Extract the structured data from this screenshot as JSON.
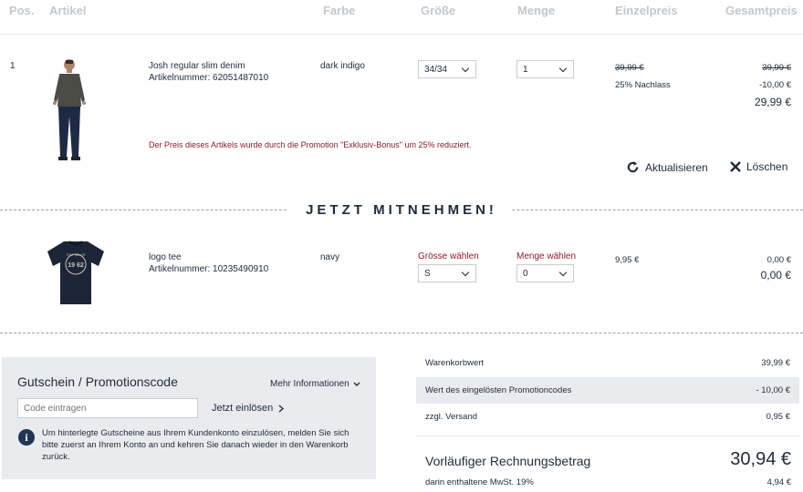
{
  "header": {
    "pos": "Pos.",
    "artikel": "Artikel",
    "farbe": "Farbe",
    "groesse": "Größe",
    "menge": "Menge",
    "einzelpreis": "Einzelpreis",
    "gesamtpreis": "Gesamtpreis"
  },
  "item1": {
    "pos": "1",
    "name": "Josh regular slim denim",
    "article_no": "Artikelnummer: 62051487010",
    "color": "dark indigo",
    "size": "34/34",
    "qty": "1",
    "unit_price_old": "39,99 €",
    "discount_label": "25% Nachlass",
    "total_old": "39,99 €",
    "total_discount": "-10,00 €",
    "total_new": "29,99 €",
    "promo_note": "Der Preis dieses Artikels wurde durch die Promotion \"Exklusiv-Bonus\" um 25% reduziert.",
    "update_label": "Aktualisieren",
    "delete_label": "Löschen"
  },
  "banner": "JETZT MITNEHMEN!",
  "item2": {
    "name": "logo tee",
    "article_no": "Artikelnummer: 10235490910",
    "color": "navy",
    "size_label": "Grösse wählen",
    "size": "S",
    "qty_label": "Menge wählen",
    "qty": "0",
    "unit_price": "9,95 €",
    "total_small": "0,00 €",
    "total": "0,00 €",
    "shirt_print": "TOM TAILOR 19 62"
  },
  "voucher": {
    "title": "Gutschein / Promotionscode",
    "more_info": "Mehr Informationen",
    "placeholder": "Code eintragen",
    "redeem": "Jetzt einlösen",
    "info": "Um hinterlegte Gutscheine aus Ihrem Kundenkonto einzulösen, melden Sie sich bitte zuerst an Ihrem Konto an und kehren Sie danach wieder in den Warenkorb zurück."
  },
  "totals": {
    "cart_value_label": "Warenkorbwert",
    "cart_value": "39,99 €",
    "promo_label": "Wert des eingelösten Promotioncodes",
    "promo_value": "- 10,00 €",
    "shipping_label": "zzgl. Versand",
    "shipping_value": "0,95 €",
    "grand_label": "Vorläufiger Rechnungsbetrag",
    "grand_value": "30,94 €",
    "vat_label": "darin enthaltene MwSt. 19%",
    "vat_value": "4,94 €"
  },
  "colors": {
    "accent_red": "#8c1c2c",
    "navy": "#1f3654",
    "panel_bg": "#e9ebee"
  }
}
